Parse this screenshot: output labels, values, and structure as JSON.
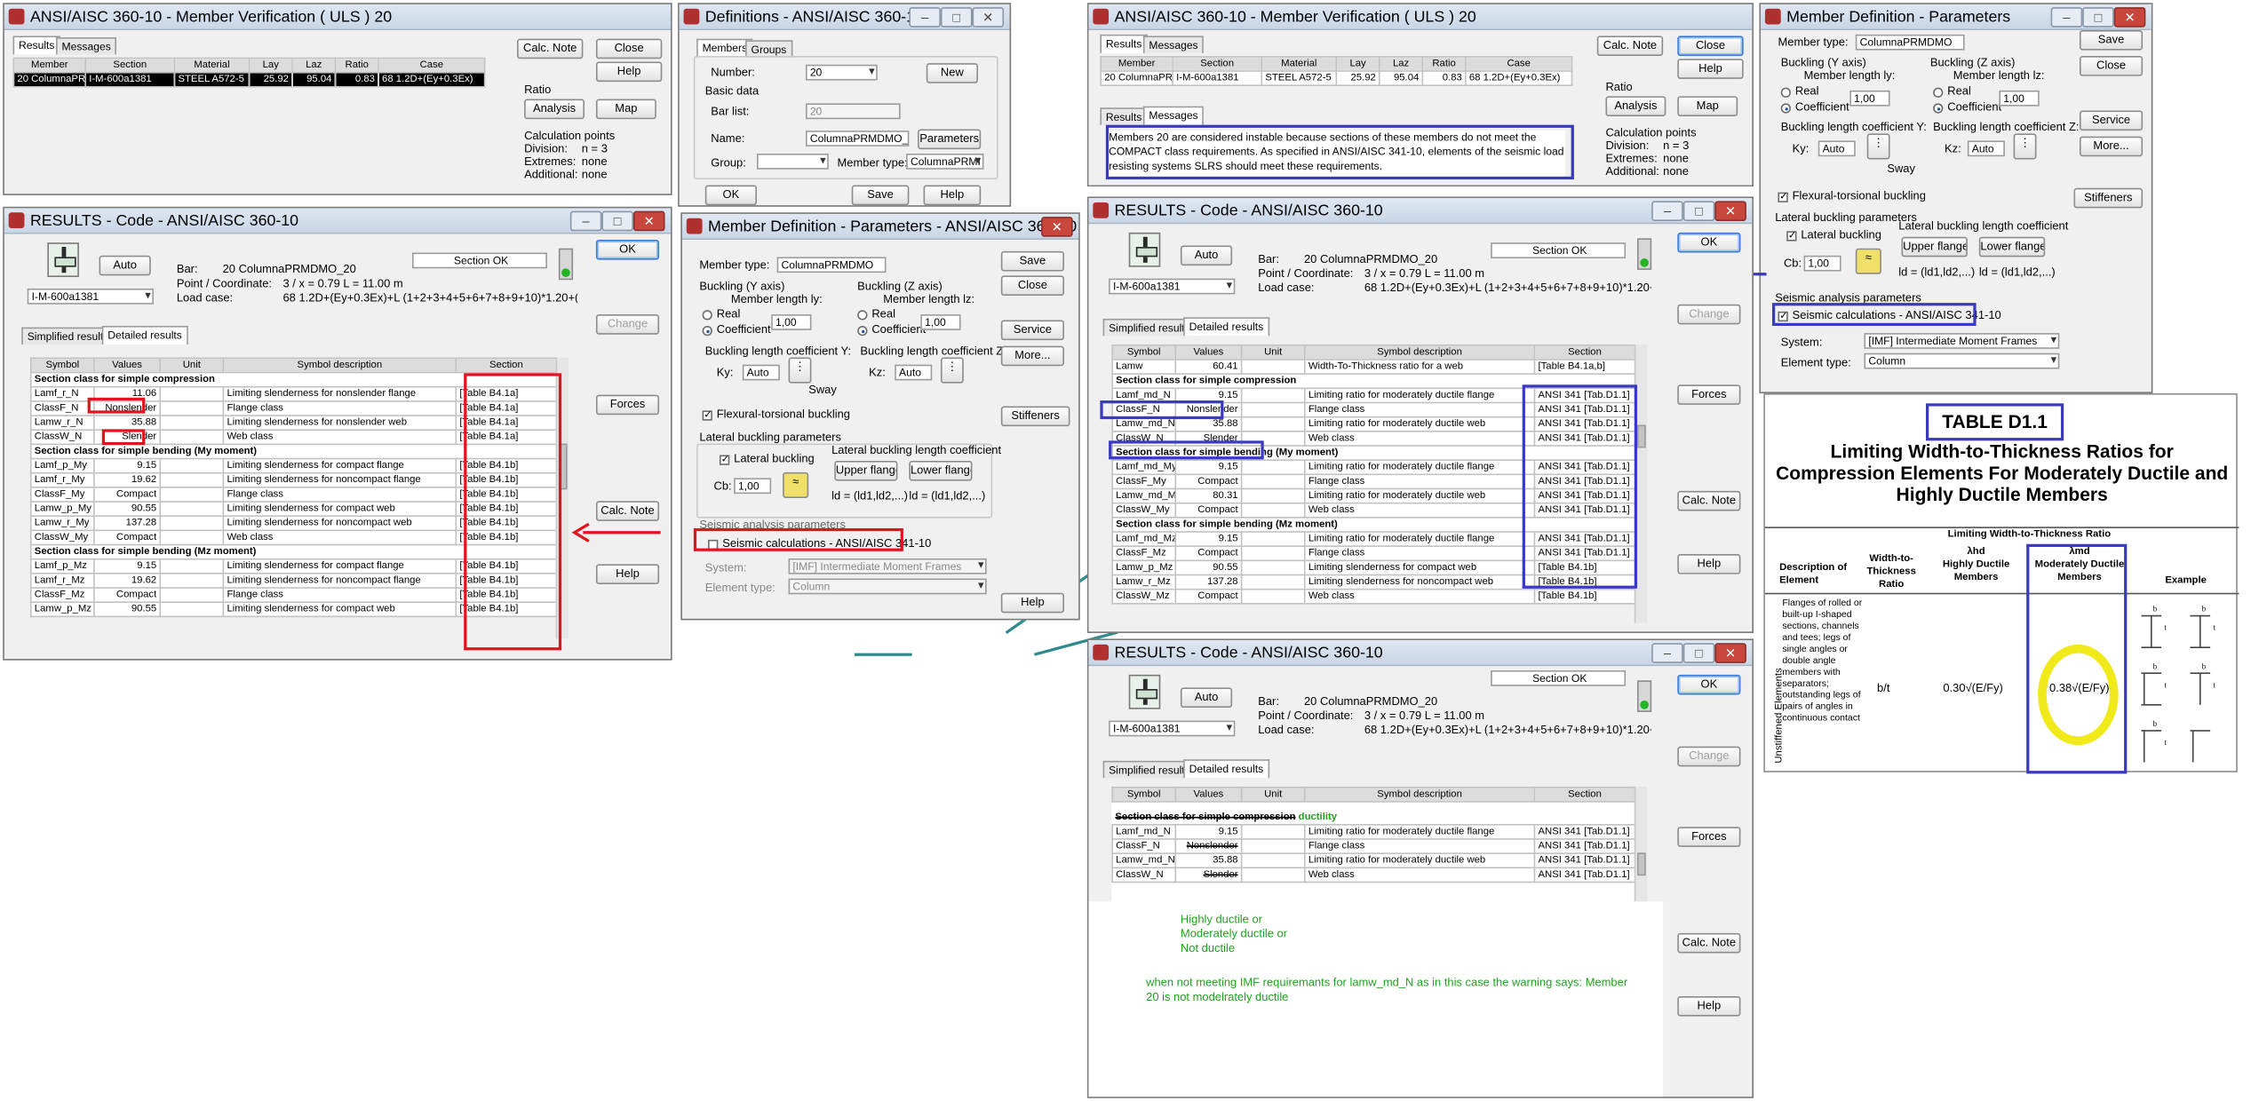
{
  "verify_left": {
    "title": "ANSI/AISC 360-10 - Member Verification ( ULS ) 20",
    "tabs": [
      "Results",
      "Messages"
    ],
    "headers": [
      "Member",
      "Section",
      "Material",
      "Lay",
      "Laz",
      "Ratio",
      "Case"
    ],
    "row": [
      "20 ColumnaPRMD",
      "I-M-600a1381",
      "STEEL A572-5",
      "25.92",
      "95.04",
      "0.83",
      "68 1.2D+(Ey+0.3Ex)"
    ],
    "buttons": {
      "calc_note": "Calc. Note",
      "close": "Close",
      "help": "Help",
      "analysis": "Analysis",
      "map": "Map"
    },
    "ratio_label": "Ratio",
    "calc_points": "Calculation points",
    "division": "Division:",
    "division_val": "n = 3",
    "extremes": "Extremes:",
    "extremes_val": "none",
    "additional": "Additional:",
    "additional_val": "none"
  },
  "definitions": {
    "title": "Definitions - ANSI/AISC 360-10",
    "tabs": [
      "Members",
      "Groups"
    ],
    "number_label": "Number:",
    "number_val": "20",
    "new": "New",
    "basic_data": "Basic data",
    "bar_list_label": "Bar list:",
    "bar_list_val": "20",
    "name_label": "Name:",
    "name_val": "ColumnaPRMDMO_20",
    "parameters": "Parameters",
    "group_label": "Group:",
    "member_type_label": "Member type:",
    "member_type_val": "ColumnaPRMI",
    "ok": "OK",
    "save": "Save",
    "help": "Help"
  },
  "results_left": {
    "title": "RESULTS - Code - ANSI/AISC 360-10",
    "auto": "Auto",
    "section_val": "I-M-600a1381",
    "bar_label": "Bar:",
    "bar_val": "20  ColumnaPRMDMO_20",
    "point_label": "Point / Coordinate:",
    "point_val": "3 / x = 0.79 L = 11.00 m",
    "load_label": "Load case:",
    "load_val": "68 1.2D+(Ey+0.3Ex)+L  (1+2+3+4+5+6+7+8+9+10)*1.20+(11+",
    "status": "Section OK",
    "tabs": [
      "Simplified results",
      "Detailed results"
    ],
    "headers": [
      "Symbol",
      "Values",
      "Unit",
      "Symbol description",
      "Section"
    ],
    "rows": [
      {
        "h": "Section class for simple compression"
      },
      {
        "c": [
          "Lamf_r_N",
          "11.06",
          "",
          "Limiting slenderness for nonslender flange",
          "[Table B4.1a]"
        ]
      },
      {
        "c": [
          "ClassF_N",
          "Nonslender",
          "",
          "Flange class",
          "[Table B4.1a]"
        ]
      },
      {
        "c": [
          "Lamw_r_N",
          "35.88",
          "",
          "Limiting slenderness for nonslender web",
          "[Table B4.1a]"
        ]
      },
      {
        "c": [
          "ClassW_N",
          "Slender",
          "",
          "Web class",
          "[Table B4.1a]"
        ]
      },
      {
        "h": "Section class for simple bending (My moment)"
      },
      {
        "c": [
          "Lamf_p_My",
          "9.15",
          "",
          "Limiting slenderness for compact flange",
          "[Table B4.1b]"
        ]
      },
      {
        "c": [
          "Lamf_r_My",
          "19.62",
          "",
          "Limiting slenderness for noncompact flange",
          "[Table B4.1b]"
        ]
      },
      {
        "c": [
          "ClassF_My",
          "Compact",
          "",
          "Flange class",
          "[Table B4.1b]"
        ]
      },
      {
        "c": [
          "Lamw_p_My",
          "90.55",
          "",
          "Limiting slenderness for compact web",
          "[Table B4.1b]"
        ]
      },
      {
        "c": [
          "Lamw_r_My",
          "137.28",
          "",
          "Limiting slenderness for noncompact web",
          "[Table B4.1b]"
        ]
      },
      {
        "c": [
          "ClassW_My",
          "Compact",
          "",
          "Web class",
          "[Table B4.1b]"
        ]
      },
      {
        "h": "Section class for simple bending (Mz moment)"
      },
      {
        "c": [
          "Lamf_p_Mz",
          "9.15",
          "",
          "Limiting slenderness for compact flange",
          "[Table B4.1b]"
        ]
      },
      {
        "c": [
          "Lamf_r_Mz",
          "19.62",
          "",
          "Limiting slenderness for noncompact flange",
          "[Table B4.1b]"
        ]
      },
      {
        "c": [
          "ClassF_Mz",
          "Compact",
          "",
          "Flange class",
          "[Table B4.1b]"
        ]
      },
      {
        "c": [
          "Lamw_p_Mz",
          "90.55",
          "",
          "Limiting slenderness for compact web",
          "[Table B4.1b]"
        ]
      }
    ],
    "buttons": {
      "ok": "OK",
      "change": "Change",
      "forces": "Forces",
      "calc_note": "Calc. Note",
      "help": "Help"
    }
  },
  "member_def_mid": {
    "title": "Member Definition - Parameters - ANSI/AISC 360-10",
    "member_type_label": "Member type:",
    "member_type_val": "ColumnaPRMDMO",
    "buckling_y": "Buckling (Y axis)",
    "member_length_y": "Member length ly:",
    "buckling_z": "Buckling (Z axis)",
    "member_length_z": "Member length lz:",
    "real": "Real",
    "coefficient": "Coefficient",
    "coef_val": "1,00",
    "blc_y": "Buckling length coefficient Y:",
    "blc_z": "Buckling length coefficient Z:",
    "ky": "Ky:",
    "kz": "Kz:",
    "auto": "Auto",
    "sway": "Sway",
    "flexural": "Flexural-torsional buckling",
    "lateral_params": "Lateral buckling parameters",
    "lateral": "Lateral buckling",
    "lblc": "Lateral buckling length coefficient",
    "upper": "Upper flange",
    "lower": "Lower flange",
    "cb": "Cb:",
    "ld": "ld = (ld1,ld2,...)",
    "seismic_params": "Seismic analysis parameters",
    "seismic_calc": "Seismic calculations - ANSI/AISC 341-10",
    "system_label": "System:",
    "system_val": "[IMF] Intermediate Moment Frames",
    "element_label": "Element type:",
    "element_val": "Column",
    "buttons": {
      "save": "Save",
      "close": "Close",
      "service": "Service",
      "more": "More...",
      "stiffeners": "Stiffeners",
      "help": "Help"
    }
  },
  "verify_right": {
    "title": "ANSI/AISC 360-10 - Member Verification ( ULS ) 20",
    "warning": "Members 20 are considered instable because sections of these members do not meet the COMPACT class requirements. As specified in ANSI/AISC 341-10, elements of the seismic load resisting systems SLRS should meet these requirements."
  },
  "member_def_right": {
    "title": "Member Definition - Parameters",
    "member_type_val": "ColumnaPRMDMO",
    "length_val": "1,00",
    "system_val": "[IMF] Intermediate Moment Frames",
    "element_val": "Column",
    "seismic_calc": "Seismic calculations - ANSI/AISC 341-10"
  },
  "results_right_top": {
    "rows": [
      {
        "c": [
          "Lamw",
          "60.41",
          "",
          "Width-To-Thickness ratio for a web",
          "[Table B4.1a,b]"
        ]
      },
      {
        "h": "Section class for simple compression"
      },
      {
        "c": [
          "Lamf_md_N",
          "9.15",
          "",
          "Limiting ratio for moderately ductile flange",
          "ANSI 341 [Tab.D1.1]"
        ]
      },
      {
        "c": [
          "ClassF_N",
          "Nonslender",
          "",
          "Flange class",
          "ANSI 341 [Tab.D1.1]"
        ]
      },
      {
        "c": [
          "Lamw_md_N",
          "35.88",
          "",
          "Limiting ratio for moderately ductile web",
          "ANSI 341 [Tab.D1.1]"
        ]
      },
      {
        "c": [
          "ClassW_N",
          "Slender",
          "",
          "Web class",
          "ANSI 341 [Tab.D1.1]"
        ]
      },
      {
        "h": "Section class for simple bending (My moment)"
      },
      {
        "c": [
          "Lamf_md_My",
          "9.15",
          "",
          "Limiting ratio for moderately ductile flange",
          "ANSI 341 [Tab.D1.1]"
        ]
      },
      {
        "c": [
          "ClassF_My",
          "Compact",
          "",
          "Flange class",
          "ANSI 341 [Tab.D1.1]"
        ]
      },
      {
        "c": [
          "Lamw_md_M",
          "80.31",
          "",
          "Limiting ratio for moderately ductile web",
          "ANSI 341 [Tab.D1.1]"
        ]
      },
      {
        "c": [
          "ClassW_My",
          "Compact",
          "",
          "Web class",
          "ANSI 341 [Tab.D1.1]"
        ]
      },
      {
        "h": "Section class for simple bending (Mz moment)"
      },
      {
        "c": [
          "Lamf_md_Mz",
          "9.15",
          "",
          "Limiting ratio for moderately ductile flange",
          "ANSI 341 [Tab.D1.1]"
        ]
      },
      {
        "c": [
          "ClassF_Mz",
          "Compact",
          "",
          "Flange class",
          "ANSI 341 [Tab.D1.1]"
        ]
      },
      {
        "c": [
          "Lamw_p_Mz",
          "90.55",
          "",
          "Limiting slenderness for compact web",
          "[Table B4.1b]"
        ]
      },
      {
        "c": [
          "Lamw_r_Mz",
          "137.28",
          "",
          "Limiting slenderness for noncompact web",
          "[Table B4.1b]"
        ]
      },
      {
        "c": [
          "ClassW_Mz",
          "Compact",
          "",
          "Web class",
          "[Table B4.1b]"
        ]
      }
    ]
  },
  "results_right_bottom": {
    "section_heading": "Section class for simple compression",
    "ductility": "ductility",
    "rows": [
      {
        "c": [
          "Lamf_md_N",
          "9.15",
          "",
          "Limiting ratio for moderately ductile flange",
          "ANSI 341 [Tab.D1.1]"
        ]
      },
      {
        "c": [
          "ClassF_N",
          "Nonslender",
          "",
          "Flange class",
          "ANSI 341 [Tab.D1.1]"
        ]
      },
      {
        "c": [
          "Lamw_md_N",
          "35.88",
          "",
          "Limiting ratio for moderately ductile web",
          "ANSI 341 [Tab.D1.1]"
        ]
      },
      {
        "c": [
          "ClassW_N",
          "Slender",
          "",
          "Web class",
          "ANSI 341 [Tab.D1.1]"
        ]
      }
    ],
    "note_lines": [
      "Highly ductile or",
      "Moderately ductile or",
      "Not ductile"
    ],
    "note2": "when not meeting IMF requiremants for lamw_md_N as in this case the warning says: Member 20 is not modelrately ductile"
  },
  "table_d11": {
    "label": "TABLE D1.1",
    "title": "Limiting Width-to-Thickness Ratios for Compression Elements For Moderately Ductile and Highly Ductile Members",
    "limiting_header": "Limiting Width-to-Thickness Ratio",
    "col_desc": "Description of Element",
    "col_wt": "Width-to-Thickness Ratio",
    "col_hd_sym": "λhd",
    "col_hd": "Highly Ductile Members",
    "col_md_sym": "λmd",
    "col_md": "Moderately Ductile Members",
    "col_ex": "Example",
    "side_label": "Unstiffened Elements",
    "row_desc": "Flanges of rolled or built-up I-shaped sections, channels and tees; legs of single angles or double angle members with separators; outstanding legs of pairs of angles in continuous contact",
    "row_ratio": "b/t",
    "row_hd": "0.30√(E/Fy)",
    "row_md": "0.38√(E/Fy)",
    "example_marks": [
      "b",
      "t"
    ]
  }
}
